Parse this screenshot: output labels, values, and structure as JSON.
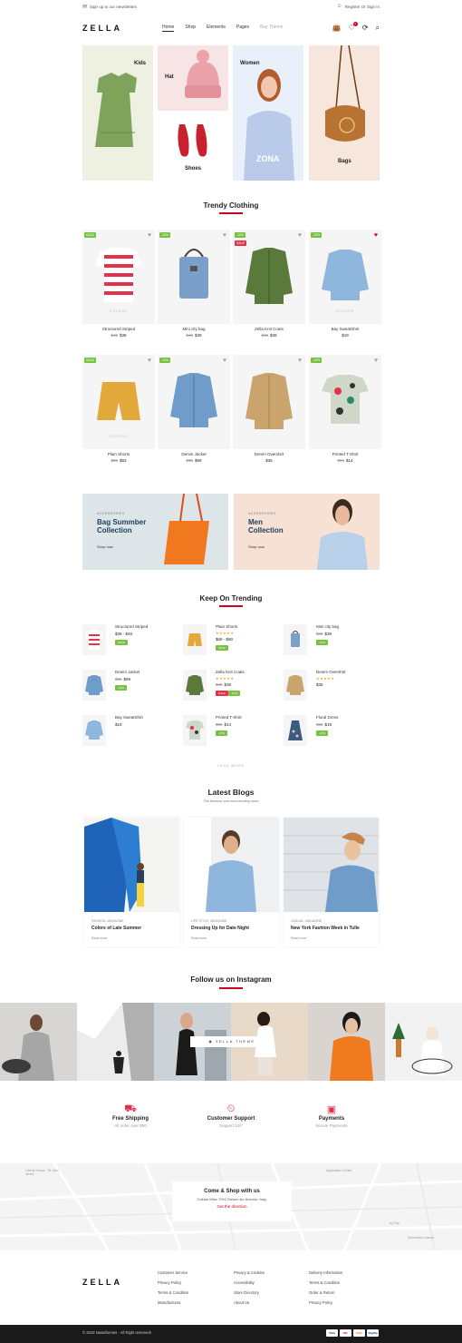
{
  "topbar": {
    "newsletter": "Sign up to our newsletters",
    "account": "Register Or Sign In"
  },
  "header": {
    "logo": "ZELLA",
    "menu": [
      "Home",
      "Shop",
      "Elements",
      "Pages",
      "Buy Theme"
    ],
    "wishlist_count": "0"
  },
  "categories": {
    "kids": "Kids",
    "hat": "Hat",
    "shoes": "Shoes",
    "women": "Women",
    "bags": "Bags"
  },
  "trendy": {
    "title": "Trendy Clothing",
    "colors_label": "COLORS",
    "products": [
      {
        "badge": "SALE",
        "name": "Structured Striped",
        "old": "$45",
        "price": "$39"
      },
      {
        "badge": "-10%",
        "name": "Mini city bag",
        "old": "$45",
        "price": "$39"
      },
      {
        "badge": "-10%",
        "badge2": "SALE",
        "name": "Zella Knit Coats",
        "old": "$45",
        "price": "$39"
      },
      {
        "badge": "-10%",
        "name": "Bay SweatShirt",
        "old": "",
        "price": "$19"
      },
      {
        "badge": "SALE",
        "name": "Plain Shorts",
        "old": "$95",
        "price": "$83"
      },
      {
        "badge": "-10%",
        "name": "Denim Jacket",
        "old": "$95",
        "price": "$99"
      },
      {
        "badge": "",
        "name": "Denim Overshirt",
        "old": "",
        "price": "$35"
      },
      {
        "badge": "-10%",
        "name": "Printed T-Shirt",
        "old": "$95",
        "price": "$14"
      }
    ]
  },
  "promos": [
    {
      "cat": "ACCESSORIES",
      "line1": "Bag Summber",
      "line2": "Collection",
      "shop": "Shop now"
    },
    {
      "cat": "ACCESSORIES",
      "line1": "Men",
      "line2": "Collection",
      "shop": "Shop now"
    }
  ],
  "keep": {
    "title": "Keep On Trending",
    "items": [
      {
        "name": "Structured Striped",
        "price": "$39 - $45",
        "tag": "SALE"
      },
      {
        "name": "Plain Shorts",
        "stars": "★★★★★",
        "price": "$69 - $90",
        "tag": "SALE"
      },
      {
        "name": "Mini city bag",
        "price": "$39",
        "old": "$45",
        "tag": "-10%"
      },
      {
        "name": "Denim Jacket",
        "price": "$99",
        "old": "$95",
        "tag": "-10%"
      },
      {
        "name": "Zella Knit Coats",
        "stars": "★★★★★",
        "price": "$39",
        "old": "$45",
        "tag": "SALE",
        "tag2": "-10%"
      },
      {
        "name": "Denim Overshirt",
        "stars": "★★★★★",
        "price": "$35"
      },
      {
        "name": "Bay SweatShirt",
        "price": "$19"
      },
      {
        "name": "Printed T-Shirt",
        "price": "$14",
        "old": "$95",
        "tag": "-10%"
      },
      {
        "name": "Floral Dress",
        "price": "$19",
        "old": "$35",
        "tag": "-10%"
      }
    ],
    "load_more": "LOAD MORE"
  },
  "blogs": {
    "title": "Latest Blogs",
    "subtitle": "The freshest and most exciting news",
    "posts": [
      {
        "cat": "FASHION, MAGAZINE",
        "title": "Colors of Late Summer",
        "more": "Read more"
      },
      {
        "cat": "LIFE STYLE, MAGAZINE",
        "title": "Dressing Up for Date Night",
        "more": "Read more"
      },
      {
        "cat": "CASUAL, MAGAZINE",
        "title": "New York Fashion Week in Tulle",
        "more": "Read more"
      }
    ]
  },
  "instagram": {
    "title": "Follow us on Instagram",
    "button": "ZELLA THEME"
  },
  "features": [
    {
      "title": "Free Shipping",
      "sub": "All order over $50"
    },
    {
      "title": "Customer Support",
      "sub": "Support 24/7"
    },
    {
      "title": "Payments",
      "sub": "Secure Payments"
    }
  ],
  "map": {
    "title": "Come & Shop with us",
    "address": "Collata Wise 7292 Dictum Av. Antonio, Italy.",
    "link": "Get the direction",
    "labels": [
      "Liberty House - St John Street",
      "Application Centre",
      "IQ City",
      "Shoreditch Leisure"
    ]
  },
  "footer": {
    "logo": "ZELLA",
    "col1": [
      "Customer Service",
      "Privacy Policy",
      "Terms & Condition",
      "Manufactures"
    ],
    "col2": [
      "Privacy & Cookies",
      "Accessibility",
      "Store Directory",
      "About Us"
    ],
    "col3": [
      "Delivery Information",
      "Terms & Condition",
      "Order & Return",
      "Privacy Policy"
    ],
    "copyright": "© 2018 Nasathemes - All Right reserved!",
    "payments": [
      "VISA",
      "MC",
      "DISC",
      "PayPal"
    ]
  },
  "colors": {
    "accent": "#d0021b",
    "badge_green": "#7ac142",
    "badge_red": "#e2334c",
    "navy": "#1a3d5c"
  }
}
